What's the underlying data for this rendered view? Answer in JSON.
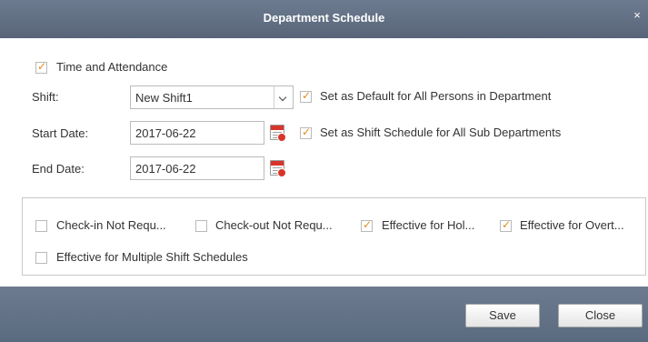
{
  "dialog": {
    "title": "Department Schedule",
    "close_glyph": "×"
  },
  "form": {
    "time_attendance": {
      "label": "Time and Attendance",
      "checked": true
    },
    "shift": {
      "label": "Shift:",
      "value": "New Shift1"
    },
    "default_all_persons": {
      "label": "Set as Default for All Persons in Department",
      "checked": true
    },
    "start_date": {
      "label": "Start Date:",
      "value": "2017-06-22"
    },
    "sub_departments": {
      "label": "Set as Shift Schedule for All Sub Departments",
      "checked": true
    },
    "end_date": {
      "label": "End Date:",
      "value": "2017-06-22"
    }
  },
  "options": {
    "checkin_not_required": {
      "label": "Check-in Not Requ...",
      "checked": false
    },
    "checkout_not_required": {
      "label": "Check-out Not Requ...",
      "checked": false
    },
    "effective_holiday": {
      "label": "Effective for Hol...",
      "checked": true
    },
    "effective_overtime": {
      "label": "Effective for Overt...",
      "checked": true
    },
    "effective_multiple": {
      "label": "Effective for Multiple Shift Schedules",
      "checked": false
    }
  },
  "buttons": {
    "save": "Save",
    "close": "Close"
  },
  "icons": {
    "calendar": "calendar-icon",
    "dropdown": "chevron-down-icon",
    "close": "close-icon"
  },
  "colors": {
    "titlebar": "#5f6d82",
    "checkmark": "#e28b1a",
    "calendar_accent": "#d9342b"
  }
}
